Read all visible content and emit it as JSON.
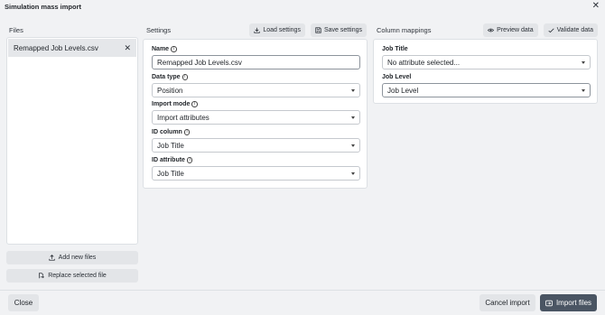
{
  "window": {
    "title": "Simulation mass import",
    "close_icon": "close-icon"
  },
  "files": {
    "header": "Files",
    "items": [
      {
        "name": "Remapped Job Levels.csv"
      }
    ],
    "add_button": "Add new files",
    "replace_button": "Replace selected file"
  },
  "settings": {
    "header": "Settings",
    "load_button": "Load settings",
    "save_button": "Save settings",
    "name_label": "Name",
    "name_value": "Remapped Job Levels.csv",
    "data_type_label": "Data type",
    "data_type_value": "Position",
    "import_mode_label": "Import mode",
    "import_mode_value": "Import attributes",
    "id_column_label": "ID column",
    "id_column_value": "Job Title",
    "id_attribute_label": "ID attribute",
    "id_attribute_value": "Job Title"
  },
  "mappings": {
    "header": "Column mappings",
    "preview_button": "Preview data",
    "validate_button": "Validate data",
    "rows": [
      {
        "label": "Job Title",
        "value": "No attribute selected..."
      },
      {
        "label": "Job Level",
        "value": "Job Level"
      }
    ]
  },
  "footer": {
    "close_button": "Close",
    "cancel_button": "Cancel import",
    "import_button": "Import files"
  },
  "colors": {
    "primary": "#4a5563",
    "panel": "#ffffff",
    "background": "#f1f2f4",
    "button": "#e3e5e8"
  }
}
